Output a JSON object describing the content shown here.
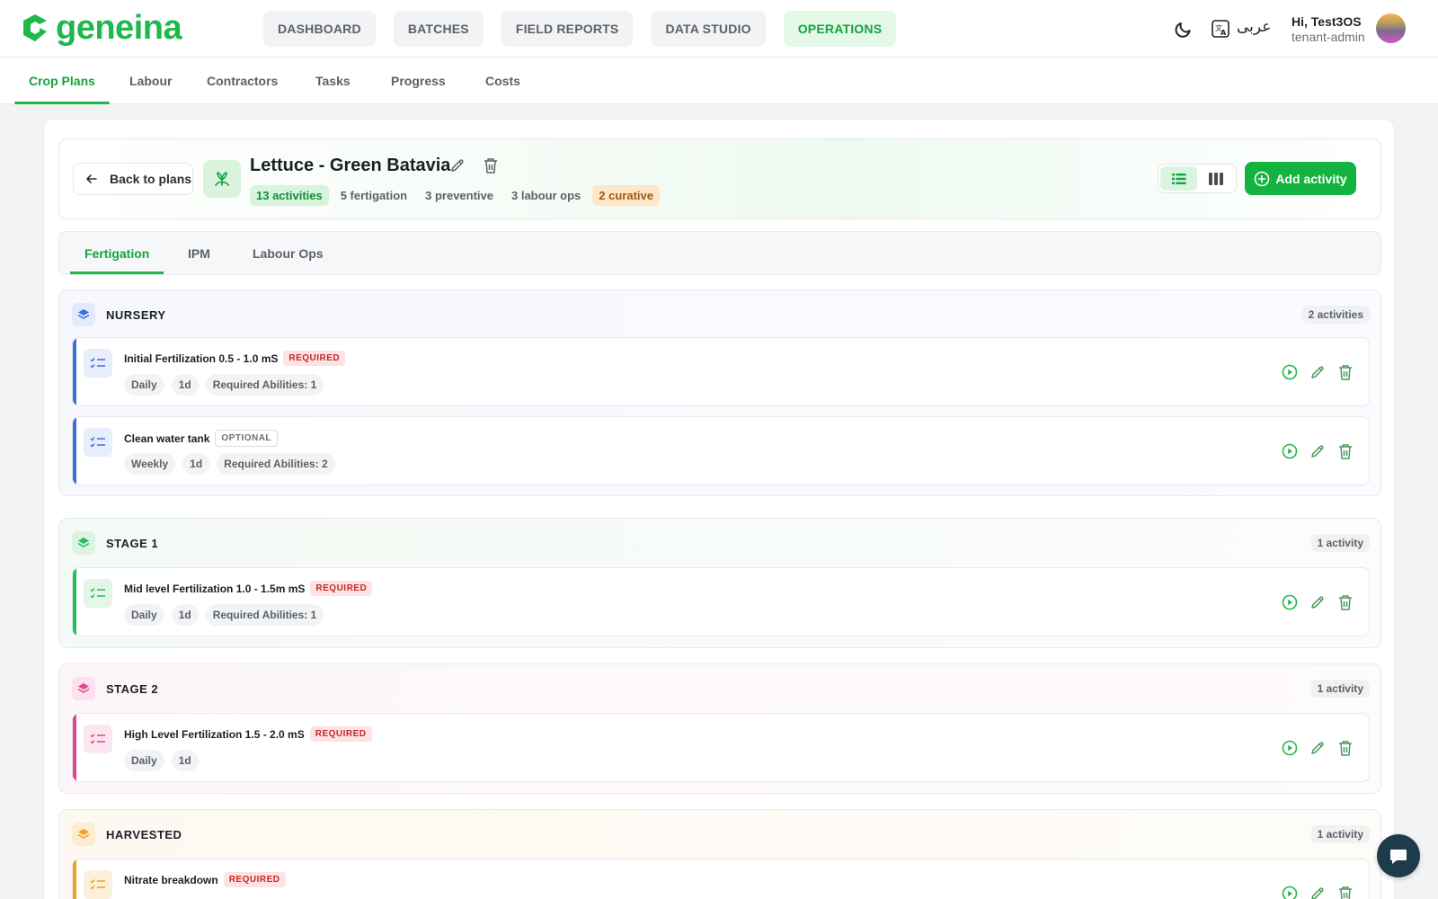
{
  "brand": {
    "name": "geneina",
    "color": "#1fb84b"
  },
  "nav": {
    "items": [
      {
        "label": "DASHBOARD",
        "active": false
      },
      {
        "label": "BATCHES",
        "active": false
      },
      {
        "label": "FIELD REPORTS",
        "active": false
      },
      {
        "label": "DATA STUDIO",
        "active": false
      },
      {
        "label": "OPERATIONS",
        "active": true
      }
    ]
  },
  "topbar": {
    "theme_icon": "moon-icon",
    "translate_icon": "translate-icon",
    "language_label": "عربى",
    "user_greeting": "Hi, Test3OS",
    "user_role": "tenant-admin"
  },
  "subnav": {
    "tabs": [
      {
        "label": "Crop Plans",
        "active": true
      },
      {
        "label": "Labour",
        "active": false
      },
      {
        "label": "Contractors",
        "active": false
      },
      {
        "label": "Tasks",
        "active": false
      },
      {
        "label": "Progress",
        "active": false
      },
      {
        "label": "Costs",
        "active": false
      }
    ]
  },
  "plan": {
    "back_label": "Back to plans",
    "title": "Lettuce - Green Batavia",
    "stats": {
      "activities": "13 activities",
      "fertigation": "5 fertigation",
      "preventive": "3 preventive",
      "labour_ops": "3 labour ops",
      "curative": "2 curative"
    },
    "add_label": "Add activity"
  },
  "tabs": [
    {
      "label": "Fertigation",
      "active": true
    },
    {
      "label": "IPM",
      "active": false
    },
    {
      "label": "Labour Ops",
      "active": false
    }
  ],
  "stages": [
    {
      "name": "NURSERY",
      "count": "2 activities",
      "color": "#3b6fe0",
      "activities": [
        {
          "name": "Initial Fertilization 0.5 - 1.0 mS",
          "badge": "REQUIRED",
          "chips": [
            "Daily",
            "1d",
            "Required Abilities: 1"
          ]
        },
        {
          "name": "Clean water tank",
          "badge": "OPTIONAL",
          "chips": [
            "Weekly",
            "1d",
            "Required Abilities: 2"
          ]
        }
      ]
    },
    {
      "name": "STAGE 1",
      "count": "1 activity",
      "color": "#22c05a",
      "activities": [
        {
          "name": "Mid level Fertilization 1.0 - 1.5m mS",
          "badge": "REQUIRED",
          "chips": [
            "Daily",
            "1d",
            "Required Abilities: 1"
          ]
        }
      ]
    },
    {
      "name": "STAGE 2",
      "count": "1 activity",
      "color": "#e0468f",
      "activities": [
        {
          "name": "High Level Fertilization 1.5 - 2.0 mS",
          "badge": "REQUIRED",
          "chips": [
            "Daily",
            "1d"
          ]
        }
      ]
    },
    {
      "name": "HARVESTED",
      "count": "1 activity",
      "color": "#f0a020",
      "activities": [
        {
          "name": "Nitrate breakdown",
          "badge": "REQUIRED",
          "chips": []
        }
      ]
    }
  ]
}
